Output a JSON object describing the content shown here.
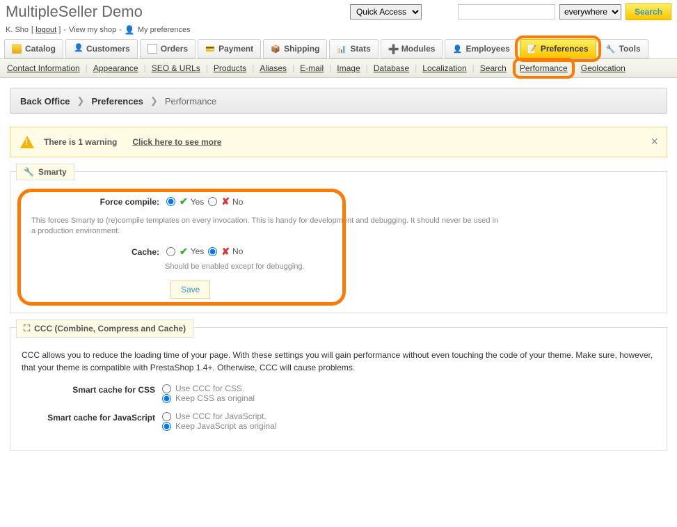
{
  "header": {
    "app_title": "MultipleSeller Demo",
    "quick_access_selected": "Quick Access",
    "search_scope_selected": "everywhere",
    "search_btn": "Search"
  },
  "userline": {
    "user": "K. Sho",
    "logout": "logout",
    "viewshop": "View my shop",
    "prefs": "My preferences"
  },
  "tabs": [
    {
      "id": "catalog",
      "label": "Catalog"
    },
    {
      "id": "customers",
      "label": "Customers"
    },
    {
      "id": "orders",
      "label": "Orders"
    },
    {
      "id": "payment",
      "label": "Payment"
    },
    {
      "id": "shipping",
      "label": "Shipping"
    },
    {
      "id": "stats",
      "label": "Stats"
    },
    {
      "id": "modules",
      "label": "Modules"
    },
    {
      "id": "employees",
      "label": "Employees"
    },
    {
      "id": "preferences",
      "label": "Preferences",
      "active": true
    },
    {
      "id": "tools",
      "label": "Tools"
    }
  ],
  "subtabs": [
    "Contact Information",
    "Appearance",
    "SEO & URLs",
    "Products",
    "Aliases",
    "E-mail",
    "Image",
    "Database",
    "Localization",
    "Search",
    "Performance",
    "Geolocation"
  ],
  "subtab_active": "Performance",
  "breadcrumb": {
    "a": "Back Office",
    "b": "Preferences",
    "c": "Performance"
  },
  "warning": {
    "text": "There is 1 warning",
    "link": "Click here to see more"
  },
  "smarty": {
    "legend": "Smarty",
    "force_label": "Force compile:",
    "yes": "Yes",
    "no": "No",
    "force_desc": "This forces Smarty to (re)compile templates on every invocation. This is handy for development and debugging. It should never be used in a production environment.",
    "cache_label": "Cache:",
    "cache_desc": "Should be enabled except for debugging.",
    "save": "Save"
  },
  "ccc": {
    "legend": "CCC (Combine, Compress and Cache)",
    "intro": "CCC allows you to reduce the loading time of your page. With these settings you will gain performance without even touching the code of your theme. Make sure, however, that your theme is compatible with PrestaShop 1.4+. Otherwise, CCC will cause problems.",
    "css_label": "Smart cache for CSS",
    "css_opt1": "Use CCC for CSS.",
    "css_opt2": "Keep CSS as original",
    "js_label": "Smart cache for JavaScript",
    "js_opt1": "Use CCC for JavaScript.",
    "js_opt2": "Keep JavaScript as original"
  }
}
